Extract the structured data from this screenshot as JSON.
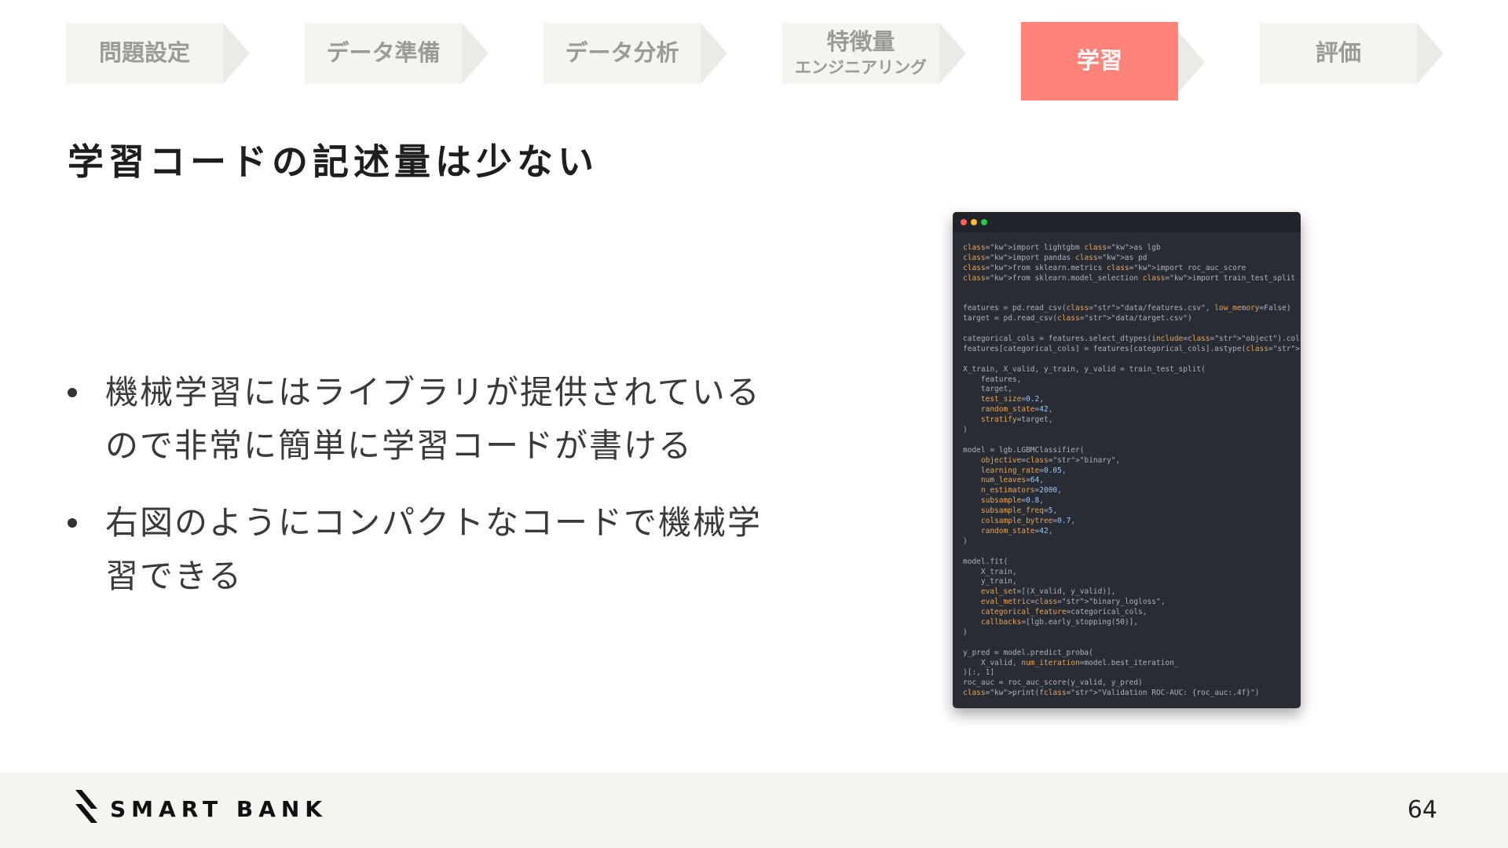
{
  "steps": [
    {
      "label": "問題設定"
    },
    {
      "label": "データ準備"
    },
    {
      "label": "データ分析"
    },
    {
      "label": "特徴量",
      "sub": "エンジニアリング"
    },
    {
      "label": "学習",
      "active": true
    },
    {
      "label": "評価"
    }
  ],
  "colors": {
    "active": "#ff8378",
    "inactive": "#f5f4ef",
    "arrow": "#ebebe6"
  },
  "title": "学習コードの記述量は少ない",
  "bullets": [
    {
      "line1": "機械学習にはライブラリが提供されている",
      "line2": "ので非常に簡単に学習コードが書ける"
    },
    {
      "line1": "右図のようにコンパクトなコードで機械学",
      "line2": "習できる"
    }
  ],
  "code": [
    "import lightgbm as lgb",
    "import pandas as pd",
    "from sklearn.metrics import roc_auc_score",
    "from sklearn.model_selection import train_test_split",
    "",
    "",
    "features = pd.read_csv(\"data/features.csv\", low_memory=False)",
    "target = pd.read_csv(\"data/target.csv\")",
    "",
    "categorical_cols = features.select_dtypes(include=\"object\").columns.tolist()",
    "features[categorical_cols] = features[categorical_cols].astype(\"category\")",
    "",
    "X_train, X_valid, y_train, y_valid = train_test_split(",
    "    features,",
    "    target,",
    "    test_size=0.2,",
    "    random_state=42,",
    "    stratify=target,",
    ")",
    "",
    "model = lgb.LGBMClassifier(",
    "    objective=\"binary\",",
    "    learning_rate=0.05,",
    "    num_leaves=64,",
    "    n_estimators=2000,",
    "    subsample=0.8,",
    "    subsample_freq=5,",
    "    colsample_bytree=0.7,",
    "    random_state=42,",
    ")",
    "",
    "model.fit(",
    "    X_train,",
    "    y_train,",
    "    eval_set=[(X_valid, y_valid)],",
    "    eval_metric=\"binary_logloss\",",
    "    categorical_feature=categorical_cols,",
    "    callbacks=[lgb.early_stopping(50)],",
    ")",
    "",
    "y_pred = model.predict_proba(",
    "    X_valid, num_iteration=model.best_iteration_",
    ")[:, 1]",
    "roc_auc = roc_auc_score(y_valid, y_pred)",
    "print(f\"Validation ROC-AUC: {roc_auc:.4f}\")"
  ],
  "footer": {
    "logo_text": "SMART BANK",
    "page_number": "64"
  }
}
